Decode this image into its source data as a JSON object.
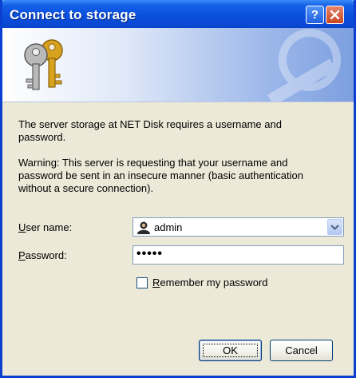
{
  "window": {
    "title": "Connect to storage",
    "help_glyph": "?"
  },
  "banner": {
    "icon": "keys-icon"
  },
  "message": {
    "line1": "The server storage at NET Disk requires a username and",
    "line2": "password.",
    "warning1": "Warning: This server is requesting that your username and",
    "warning2": "password be sent in an insecure manner (basic authentication",
    "warning3": "without a secure connection)."
  },
  "form": {
    "username_label_accel": "U",
    "username_label_rest": "ser name:",
    "username_value": "admin",
    "username_icon": "user-icon",
    "password_label_accel": "P",
    "password_label_rest": "assword:",
    "password_value": "•••••",
    "remember_accel": "R",
    "remember_rest": "emember my password",
    "remember_checked": false
  },
  "buttons": {
    "ok": "OK",
    "cancel": "Cancel"
  },
  "colors": {
    "titlebar": "#0a50de",
    "dialog_bg": "#ece9d8",
    "input_border": "#7f9db9"
  }
}
